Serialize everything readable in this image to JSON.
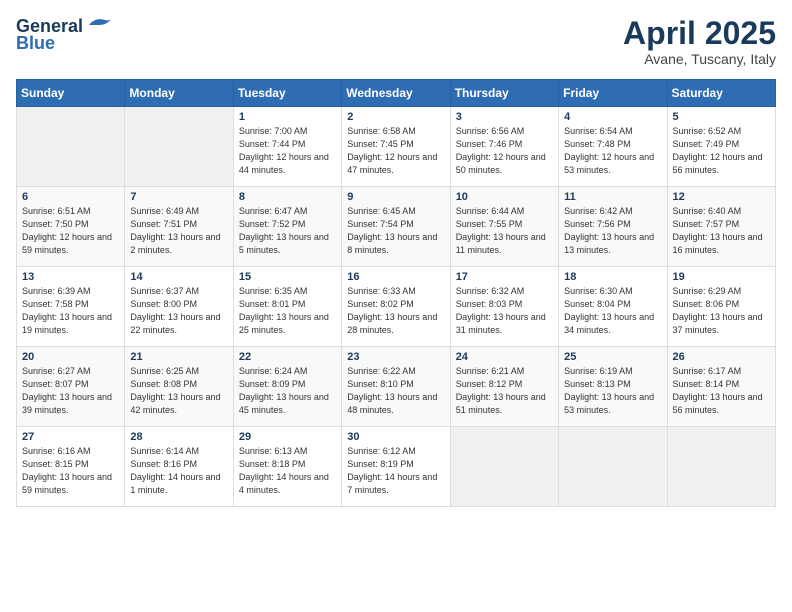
{
  "logo": {
    "general": "General",
    "blue": "Blue",
    "tagline": ""
  },
  "title": "April 2025",
  "subtitle": "Avane, Tuscany, Italy",
  "weekdays": [
    "Sunday",
    "Monday",
    "Tuesday",
    "Wednesday",
    "Thursday",
    "Friday",
    "Saturday"
  ],
  "weeks": [
    [
      null,
      null,
      {
        "day": 1,
        "sunrise": "7:00 AM",
        "sunset": "7:44 PM",
        "daylight": "12 hours and 44 minutes."
      },
      {
        "day": 2,
        "sunrise": "6:58 AM",
        "sunset": "7:45 PM",
        "daylight": "12 hours and 47 minutes."
      },
      {
        "day": 3,
        "sunrise": "6:56 AM",
        "sunset": "7:46 PM",
        "daylight": "12 hours and 50 minutes."
      },
      {
        "day": 4,
        "sunrise": "6:54 AM",
        "sunset": "7:48 PM",
        "daylight": "12 hours and 53 minutes."
      },
      {
        "day": 5,
        "sunrise": "6:52 AM",
        "sunset": "7:49 PM",
        "daylight": "12 hours and 56 minutes."
      }
    ],
    [
      {
        "day": 6,
        "sunrise": "6:51 AM",
        "sunset": "7:50 PM",
        "daylight": "12 hours and 59 minutes."
      },
      {
        "day": 7,
        "sunrise": "6:49 AM",
        "sunset": "7:51 PM",
        "daylight": "13 hours and 2 minutes."
      },
      {
        "day": 8,
        "sunrise": "6:47 AM",
        "sunset": "7:52 PM",
        "daylight": "13 hours and 5 minutes."
      },
      {
        "day": 9,
        "sunrise": "6:45 AM",
        "sunset": "7:54 PM",
        "daylight": "13 hours and 8 minutes."
      },
      {
        "day": 10,
        "sunrise": "6:44 AM",
        "sunset": "7:55 PM",
        "daylight": "13 hours and 11 minutes."
      },
      {
        "day": 11,
        "sunrise": "6:42 AM",
        "sunset": "7:56 PM",
        "daylight": "13 hours and 13 minutes."
      },
      {
        "day": 12,
        "sunrise": "6:40 AM",
        "sunset": "7:57 PM",
        "daylight": "13 hours and 16 minutes."
      }
    ],
    [
      {
        "day": 13,
        "sunrise": "6:39 AM",
        "sunset": "7:58 PM",
        "daylight": "13 hours and 19 minutes."
      },
      {
        "day": 14,
        "sunrise": "6:37 AM",
        "sunset": "8:00 PM",
        "daylight": "13 hours and 22 minutes."
      },
      {
        "day": 15,
        "sunrise": "6:35 AM",
        "sunset": "8:01 PM",
        "daylight": "13 hours and 25 minutes."
      },
      {
        "day": 16,
        "sunrise": "6:33 AM",
        "sunset": "8:02 PM",
        "daylight": "13 hours and 28 minutes."
      },
      {
        "day": 17,
        "sunrise": "6:32 AM",
        "sunset": "8:03 PM",
        "daylight": "13 hours and 31 minutes."
      },
      {
        "day": 18,
        "sunrise": "6:30 AM",
        "sunset": "8:04 PM",
        "daylight": "13 hours and 34 minutes."
      },
      {
        "day": 19,
        "sunrise": "6:29 AM",
        "sunset": "8:06 PM",
        "daylight": "13 hours and 37 minutes."
      }
    ],
    [
      {
        "day": 20,
        "sunrise": "6:27 AM",
        "sunset": "8:07 PM",
        "daylight": "13 hours and 39 minutes."
      },
      {
        "day": 21,
        "sunrise": "6:25 AM",
        "sunset": "8:08 PM",
        "daylight": "13 hours and 42 minutes."
      },
      {
        "day": 22,
        "sunrise": "6:24 AM",
        "sunset": "8:09 PM",
        "daylight": "13 hours and 45 minutes."
      },
      {
        "day": 23,
        "sunrise": "6:22 AM",
        "sunset": "8:10 PM",
        "daylight": "13 hours and 48 minutes."
      },
      {
        "day": 24,
        "sunrise": "6:21 AM",
        "sunset": "8:12 PM",
        "daylight": "13 hours and 51 minutes."
      },
      {
        "day": 25,
        "sunrise": "6:19 AM",
        "sunset": "8:13 PM",
        "daylight": "13 hours and 53 minutes."
      },
      {
        "day": 26,
        "sunrise": "6:17 AM",
        "sunset": "8:14 PM",
        "daylight": "13 hours and 56 minutes."
      }
    ],
    [
      {
        "day": 27,
        "sunrise": "6:16 AM",
        "sunset": "8:15 PM",
        "daylight": "13 hours and 59 minutes."
      },
      {
        "day": 28,
        "sunrise": "6:14 AM",
        "sunset": "8:16 PM",
        "daylight": "14 hours and 1 minute."
      },
      {
        "day": 29,
        "sunrise": "6:13 AM",
        "sunset": "8:18 PM",
        "daylight": "14 hours and 4 minutes."
      },
      {
        "day": 30,
        "sunrise": "6:12 AM",
        "sunset": "8:19 PM",
        "daylight": "14 hours and 7 minutes."
      },
      null,
      null,
      null
    ]
  ],
  "labels": {
    "sunrise_prefix": "Sunrise: ",
    "sunset_prefix": "Sunset: ",
    "daylight_prefix": "Daylight: "
  }
}
